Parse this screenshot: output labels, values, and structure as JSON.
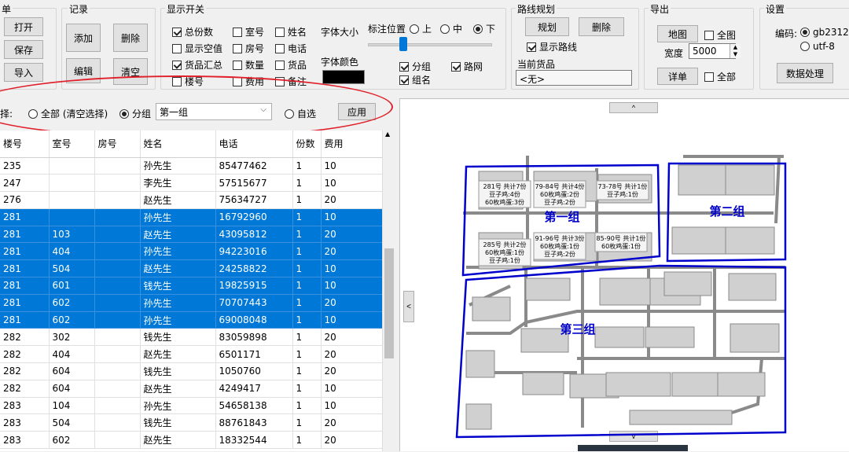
{
  "groups": {
    "list": "单",
    "record": "记录",
    "display": "显示开关",
    "route": "路线规划",
    "export": "导出",
    "settings": "设置"
  },
  "list_buttons": [
    "打开",
    "保存",
    "导入"
  ],
  "record_buttons": {
    "add": "添加",
    "delete": "删除",
    "edit": "编辑",
    "clear": "清空"
  },
  "display_checks": [
    {
      "label": "总份数",
      "on": true
    },
    {
      "label": "室号",
      "on": false
    },
    {
      "label": "姓名",
      "on": false
    },
    {
      "label": "显示空值",
      "on": false
    },
    {
      "label": "房号",
      "on": false
    },
    {
      "label": "电话",
      "on": false
    },
    {
      "label": "货品汇总",
      "on": true
    },
    {
      "label": "数量",
      "on": false
    },
    {
      "label": "货品",
      "on": false
    },
    {
      "label": "楼号",
      "on": false
    },
    {
      "label": "费用",
      "on": false
    },
    {
      "label": "备注",
      "on": false
    }
  ],
  "font_size_label": "字体大小",
  "font_color_label": "字体颜色",
  "font_color_value": "#000000",
  "label_position": {
    "label": "标注位置",
    "options": [
      "上",
      "中",
      "下"
    ],
    "selected": "下"
  },
  "extra_checks": [
    {
      "label": "分组",
      "on": true
    },
    {
      "label": "路网",
      "on": true
    },
    {
      "label": "组名",
      "on": true
    }
  ],
  "route": {
    "plan": "规划",
    "delete": "删除",
    "show_route": "显示路线",
    "show_route_on": true,
    "current_goods_label": "当前货品",
    "current_goods_value": "<无>"
  },
  "export": {
    "map": "地图",
    "all_map": "全图",
    "width_label": "宽度",
    "width_value": "5000",
    "detail": "详单",
    "all": "全部"
  },
  "settings": {
    "encoding_label": "编码:",
    "options": [
      "gb2312",
      "utf-8"
    ],
    "selected": "gb2312",
    "process": "数据处理"
  },
  "filter": {
    "label": "择:",
    "options": [
      "全部 (清空选择)",
      "分组",
      "自选"
    ],
    "selected": "分组",
    "group_value": "第一组",
    "apply": "应用"
  },
  "table": {
    "headers": [
      "楼号",
      "室号",
      "房号",
      "姓名",
      "电话",
      "份数",
      "费用"
    ],
    "rows": [
      {
        "cells": [
          "235",
          "",
          "",
          "孙先生",
          "85477462",
          "1",
          "10"
        ],
        "selected": false
      },
      {
        "cells": [
          "247",
          "",
          "",
          "李先生",
          "57515677",
          "1",
          "10"
        ],
        "selected": false
      },
      {
        "cells": [
          "276",
          "",
          "",
          "赵先生",
          "75634727",
          "1",
          "20"
        ],
        "selected": false
      },
      {
        "cells": [
          "281",
          "",
          "",
          "孙先生",
          "16792960",
          "1",
          "10"
        ],
        "selected": true
      },
      {
        "cells": [
          "281",
          "103",
          "",
          "赵先生",
          "43095812",
          "1",
          "20"
        ],
        "selected": true
      },
      {
        "cells": [
          "281",
          "404",
          "",
          "孙先生",
          "94223016",
          "1",
          "20"
        ],
        "selected": true
      },
      {
        "cells": [
          "281",
          "504",
          "",
          "赵先生",
          "24258822",
          "1",
          "10"
        ],
        "selected": true
      },
      {
        "cells": [
          "281",
          "601",
          "",
          "钱先生",
          "19825915",
          "1",
          "10"
        ],
        "selected": true
      },
      {
        "cells": [
          "281",
          "602",
          "",
          "孙先生",
          "70707443",
          "1",
          "20"
        ],
        "selected": true
      },
      {
        "cells": [
          "281",
          "602",
          "",
          "孙先生",
          "69008048",
          "1",
          "10"
        ],
        "selected": true
      },
      {
        "cells": [
          "282",
          "302",
          "",
          "钱先生",
          "83059898",
          "1",
          "20"
        ],
        "selected": false
      },
      {
        "cells": [
          "282",
          "404",
          "",
          "赵先生",
          "6501171",
          "1",
          "20"
        ],
        "selected": false
      },
      {
        "cells": [
          "282",
          "604",
          "",
          "钱先生",
          "1050760",
          "1",
          "20"
        ],
        "selected": false
      },
      {
        "cells": [
          "282",
          "604",
          "",
          "赵先生",
          "4249417",
          "1",
          "10"
        ],
        "selected": false
      },
      {
        "cells": [
          "283",
          "104",
          "",
          "孙先生",
          "54658138",
          "1",
          "10"
        ],
        "selected": false
      },
      {
        "cells": [
          "283",
          "504",
          "",
          "钱先生",
          "88761843",
          "1",
          "20"
        ],
        "selected": false
      },
      {
        "cells": [
          "283",
          "602",
          "",
          "赵先生",
          "18332544",
          "1",
          "20"
        ],
        "selected": false
      }
    ]
  },
  "map": {
    "up_arrow": "^",
    "down_arrow": "v",
    "left_arrow": "<",
    "zone_names": [
      "第一组",
      "第二组",
      "第三组"
    ],
    "building_labels": [
      {
        "lines": [
          "281号 共计7份",
          "豆子鸡:4份",
          "60枚鸡蛋:3份"
        ]
      },
      {
        "lines": [
          "79-84号 共计4份",
          "60枚鸡蛋:2份",
          "豆子鸡:2份"
        ]
      },
      {
        "lines": [
          "73-78号 共计1份",
          "豆子鸡:1份"
        ]
      },
      {
        "lines": [
          "285号 共计2份",
          "60枚鸡蛋:1份",
          "豆子鸡:1份"
        ]
      },
      {
        "lines": [
          "91-96号 共计3份",
          "60枚鸡蛋:1份",
          "豆子鸡:2份"
        ]
      },
      {
        "lines": [
          "85-90号 共计1份",
          "60枚鸡蛋:1份"
        ]
      }
    ],
    "zone_color": "#0000cc"
  }
}
